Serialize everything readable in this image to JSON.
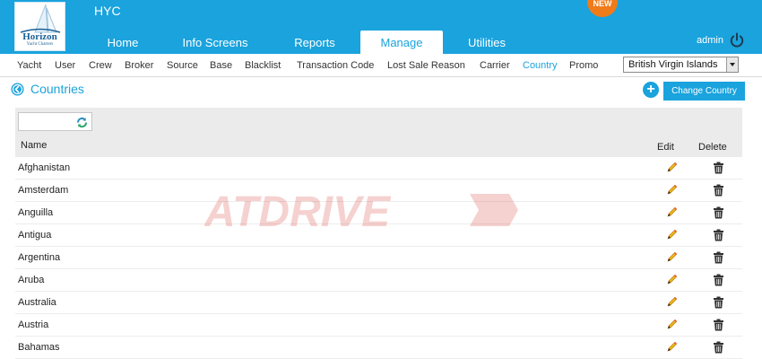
{
  "header": {
    "logo": {
      "name": "Horizon",
      "tagline": "Yacht Charters"
    },
    "app_title": "HYC",
    "new_badge": "NEW",
    "user": "admin",
    "icons": {
      "power": "power-icon"
    }
  },
  "nav": {
    "tabs": [
      {
        "label": "Home"
      },
      {
        "label": "Info Screens"
      },
      {
        "label": "Reports"
      },
      {
        "label": "Manage",
        "active": true
      },
      {
        "label": "Utilities"
      }
    ]
  },
  "subnav": {
    "items": [
      "Yacht",
      "User",
      "Crew",
      "Broker",
      "Source",
      "Base",
      "Blacklist",
      "Transaction Code",
      "Lost Sale Reason",
      "Carrier",
      "Country",
      "Promo"
    ],
    "active": "Country",
    "region_select": {
      "value": "British Virgin Islands"
    }
  },
  "page": {
    "title": "Countries",
    "add_button": "+",
    "change_button": "Change Country"
  },
  "table": {
    "filter_value": "",
    "columns": [
      "Name",
      "Edit",
      "Delete"
    ],
    "rows": [
      "Afghanistan",
      "Amsterdam",
      "Anguilla",
      "Antigua",
      "Argentina",
      "Aruba",
      "Australia",
      "Austria",
      "Bahamas"
    ]
  },
  "watermark": "ATDRIVE",
  "colors": {
    "accent": "#1aa3dd",
    "badge": "#f07b1a",
    "edit_icon": "#e8a817",
    "delete_icon": "#333333"
  }
}
